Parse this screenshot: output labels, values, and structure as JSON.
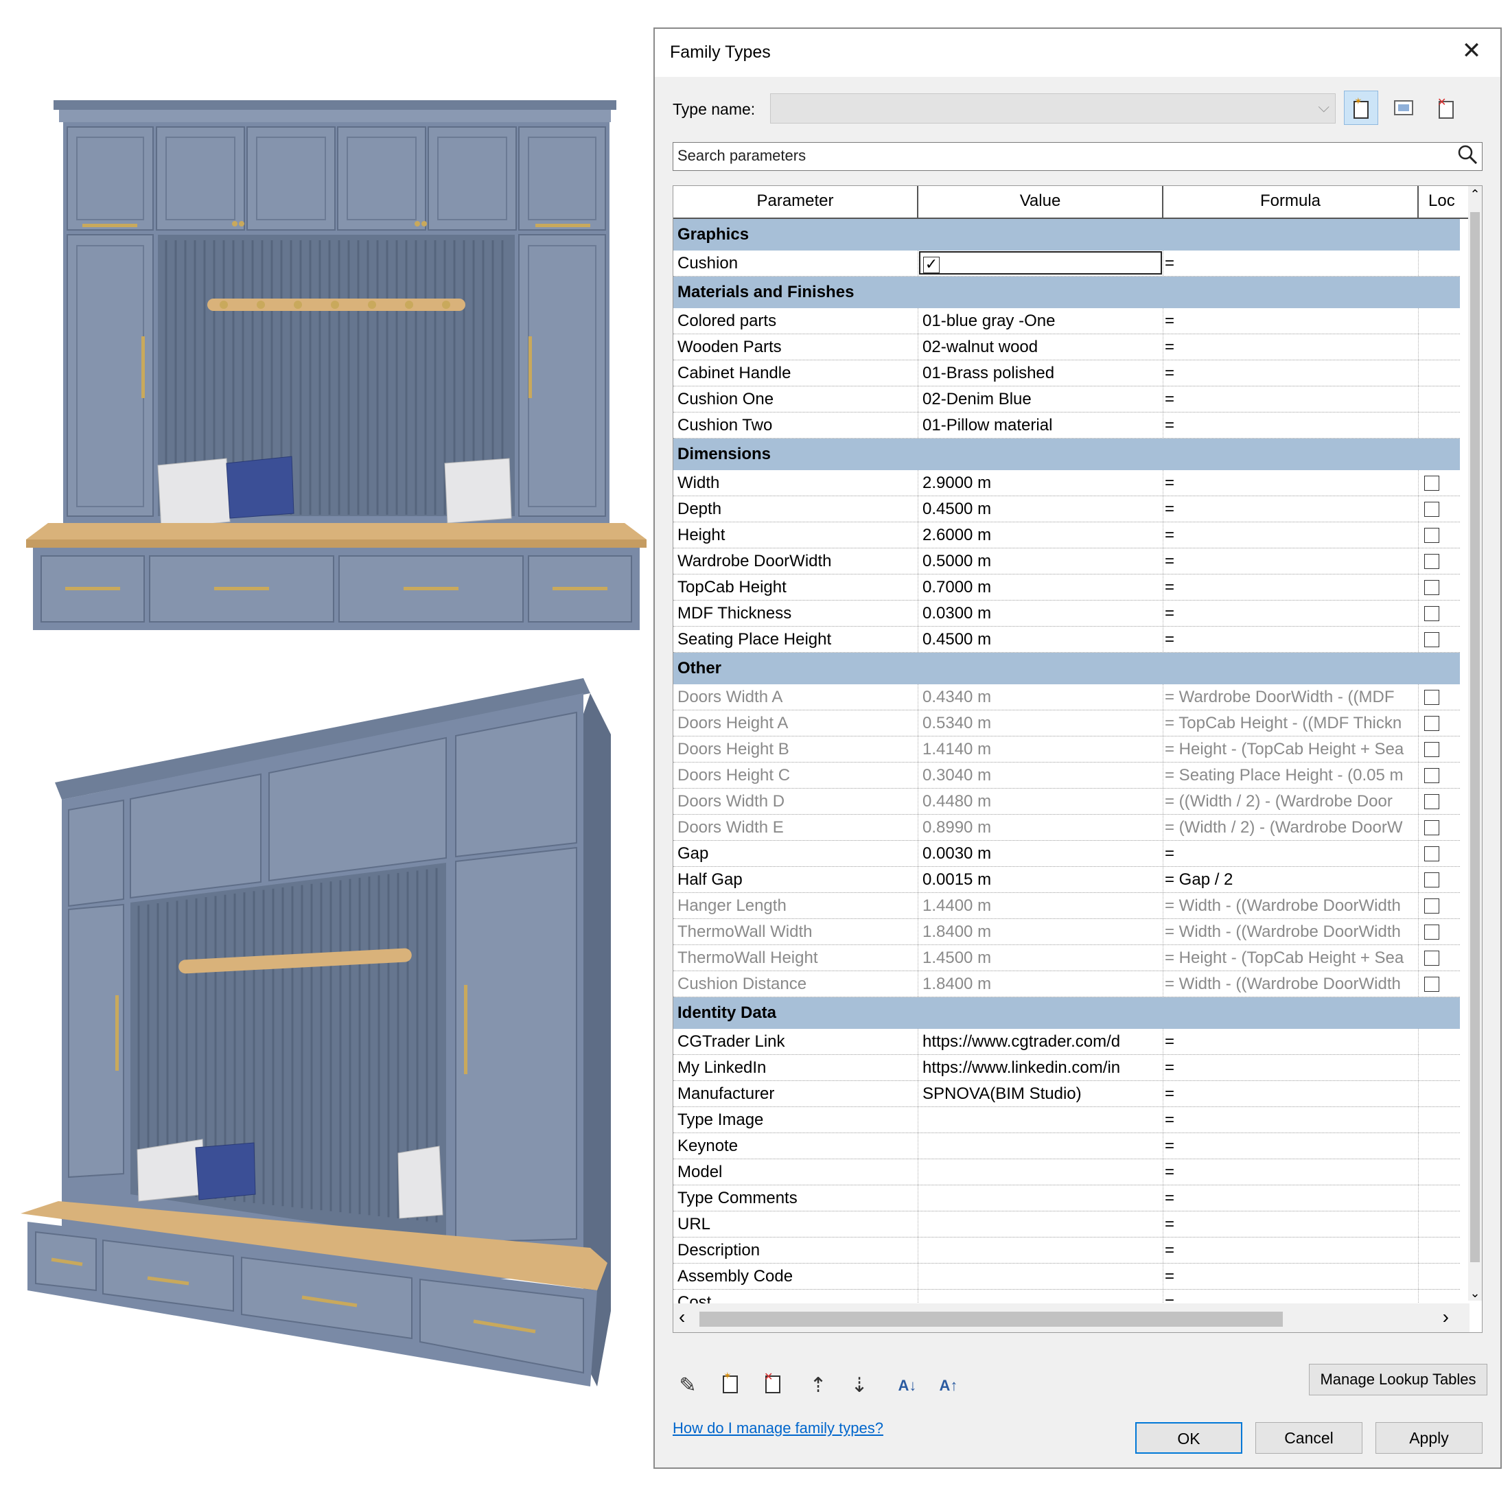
{
  "dialog": {
    "title": "Family Types",
    "close_glyph": "✕",
    "type_name_label": "Type name:",
    "type_name_value": "",
    "search_placeholder": "Search parameters",
    "columns": [
      "Parameter",
      "Value",
      "Formula",
      "Loc"
    ],
    "groups": [
      {
        "name": "Graphics",
        "rows": [
          {
            "param": "Cushion",
            "value": "",
            "formula": "=",
            "lock": null,
            "checkbox_value": true,
            "dim": false
          }
        ]
      },
      {
        "name": "Materials and Finishes",
        "rows": [
          {
            "param": "Colored parts",
            "value": "01-blue gray -One",
            "formula": "=",
            "lock": null,
            "dim": false
          },
          {
            "param": "Wooden Parts",
            "value": "02-walnut wood",
            "formula": "=",
            "lock": null,
            "dim": false
          },
          {
            "param": "Cabinet Handle",
            "value": "01-Brass polished",
            "formula": "=",
            "lock": null,
            "dim": false
          },
          {
            "param": "Cushion One",
            "value": "02-Denim Blue",
            "formula": "=",
            "lock": null,
            "dim": false
          },
          {
            "param": "Cushion Two",
            "value": "01-Pillow material",
            "formula": "=",
            "lock": null,
            "dim": false
          }
        ]
      },
      {
        "name": "Dimensions",
        "rows": [
          {
            "param": "Width",
            "value": "2.9000 m",
            "formula": "=",
            "lock": false,
            "dim": false
          },
          {
            "param": "Depth",
            "value": "0.4500 m",
            "formula": "=",
            "lock": false,
            "dim": false
          },
          {
            "param": "Height",
            "value": "2.6000 m",
            "formula": "=",
            "lock": false,
            "dim": false
          },
          {
            "param": "Wardrobe DoorWidth",
            "value": "0.5000 m",
            "formula": "=",
            "lock": false,
            "dim": false
          },
          {
            "param": "TopCab Height",
            "value": "0.7000 m",
            "formula": "=",
            "lock": false,
            "dim": false
          },
          {
            "param": "MDF Thickness",
            "value": "0.0300 m",
            "formula": "=",
            "lock": false,
            "dim": false
          },
          {
            "param": "Seating Place Height",
            "value": "0.4500 m",
            "formula": "=",
            "lock": false,
            "dim": false
          }
        ]
      },
      {
        "name": "Other",
        "rows": [
          {
            "param": "Doors Width A",
            "value": "0.4340 m",
            "formula": "= Wardrobe DoorWidth - ((MDF",
            "lock": false,
            "dim": true
          },
          {
            "param": "Doors Height A",
            "value": "0.5340 m",
            "formula": "= TopCab Height - ((MDF Thickn",
            "lock": false,
            "dim": true
          },
          {
            "param": "Doors Height B",
            "value": "1.4140 m",
            "formula": "= Height - (TopCab Height + Sea",
            "lock": false,
            "dim": true
          },
          {
            "param": "Doors Height C",
            "value": "0.3040 m",
            "formula": "= Seating Place Height - (0.05 m",
            "lock": false,
            "dim": true
          },
          {
            "param": "Doors Width D",
            "value": "0.4480 m",
            "formula": "= ((Width / 2) - (Wardrobe Door",
            "lock": false,
            "dim": true
          },
          {
            "param": "Doors Width E",
            "value": "0.8990 m",
            "formula": "= (Width / 2) - (Wardrobe DoorW",
            "lock": false,
            "dim": true
          },
          {
            "param": "Gap",
            "value": "0.0030 m",
            "formula": "=",
            "lock": false,
            "dim": false
          },
          {
            "param": "Half Gap",
            "value": "0.0015 m",
            "formula": "= Gap / 2",
            "lock": false,
            "dim": false
          },
          {
            "param": "Hanger Length",
            "value": "1.4400 m",
            "formula": "= Width - ((Wardrobe DoorWidth",
            "lock": false,
            "dim": true
          },
          {
            "param": "ThermoWall Width",
            "value": "1.8400 m",
            "formula": "= Width - ((Wardrobe DoorWidth",
            "lock": false,
            "dim": true
          },
          {
            "param": "ThermoWall Height",
            "value": "1.4500 m",
            "formula": "= Height - (TopCab Height + Sea",
            "lock": false,
            "dim": true
          },
          {
            "param": "Cushion Distance",
            "value": "1.8400 m",
            "formula": "= Width - ((Wardrobe DoorWidth",
            "lock": false,
            "dim": true
          }
        ]
      },
      {
        "name": "Identity Data",
        "rows": [
          {
            "param": "CGTrader Link",
            "value": "https://www.cgtrader.com/d",
            "formula": "=",
            "lock": null,
            "dim": false
          },
          {
            "param": "My LinkedIn",
            "value": "https://www.linkedin.com/in",
            "formula": "=",
            "lock": null,
            "dim": false
          },
          {
            "param": "Manufacturer",
            "value": "SPNOVA(BIM Studio)",
            "formula": "=",
            "lock": null,
            "dim": false
          },
          {
            "param": "Type Image",
            "value": "",
            "formula": "=",
            "lock": null,
            "dim": false
          },
          {
            "param": "Keynote",
            "value": "",
            "formula": "=",
            "lock": null,
            "dim": false
          },
          {
            "param": "Model",
            "value": "",
            "formula": "=",
            "lock": null,
            "dim": false
          },
          {
            "param": "Type Comments",
            "value": "",
            "formula": "=",
            "lock": null,
            "dim": false
          },
          {
            "param": "URL",
            "value": "",
            "formula": "=",
            "lock": null,
            "dim": false
          },
          {
            "param": "Description",
            "value": "",
            "formula": "=",
            "lock": null,
            "dim": false
          },
          {
            "param": "Assembly Code",
            "value": "",
            "formula": "=",
            "lock": null,
            "dim": false
          },
          {
            "param": "Cost",
            "value": "",
            "formula": "=",
            "lock": null,
            "dim": false
          }
        ]
      }
    ],
    "manage_lookup_label": "Manage Lookup Tables",
    "help_link": "How do I manage family types?",
    "ok_label": "OK",
    "cancel_label": "Cancel",
    "apply_label": "Apply"
  },
  "colors": {
    "group_header_bg": "#a7bfd7",
    "cabinet_blue": "#7a8aa6",
    "wood": "#d9b27a",
    "brass": "#c9a95c",
    "denim": "#3b4f96",
    "pillow": "#e6e6e8"
  }
}
